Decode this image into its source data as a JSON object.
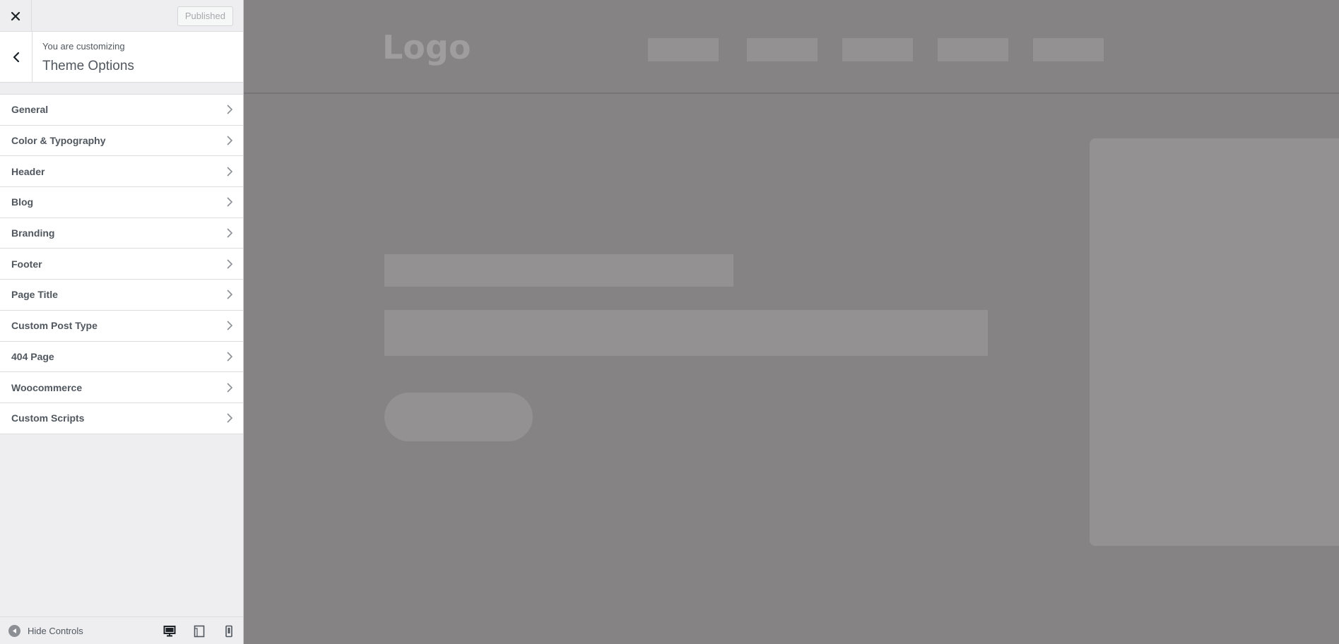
{
  "topbar": {
    "publish_label": "Published"
  },
  "section": {
    "customizing_label": "You are customizing",
    "title": "Theme Options"
  },
  "panels": [
    {
      "label": "General"
    },
    {
      "label": "Color & Typography"
    },
    {
      "label": "Header"
    },
    {
      "label": "Blog"
    },
    {
      "label": "Branding"
    },
    {
      "label": "Footer"
    },
    {
      "label": "Page Title"
    },
    {
      "label": "Custom Post Type"
    },
    {
      "label": "404 Page"
    },
    {
      "label": "Woocommerce"
    },
    {
      "label": "Custom Scripts"
    }
  ],
  "footer": {
    "hide_controls_label": "Hide Controls",
    "devices": [
      "desktop-icon",
      "tablet-icon",
      "mobile-icon"
    ]
  },
  "preview": {
    "logo": "Logo"
  },
  "colors": {
    "sidebar_bg": "#eeeef0",
    "preview_bg": "#858384",
    "placeholder": "#939192",
    "text": "#50575e"
  }
}
